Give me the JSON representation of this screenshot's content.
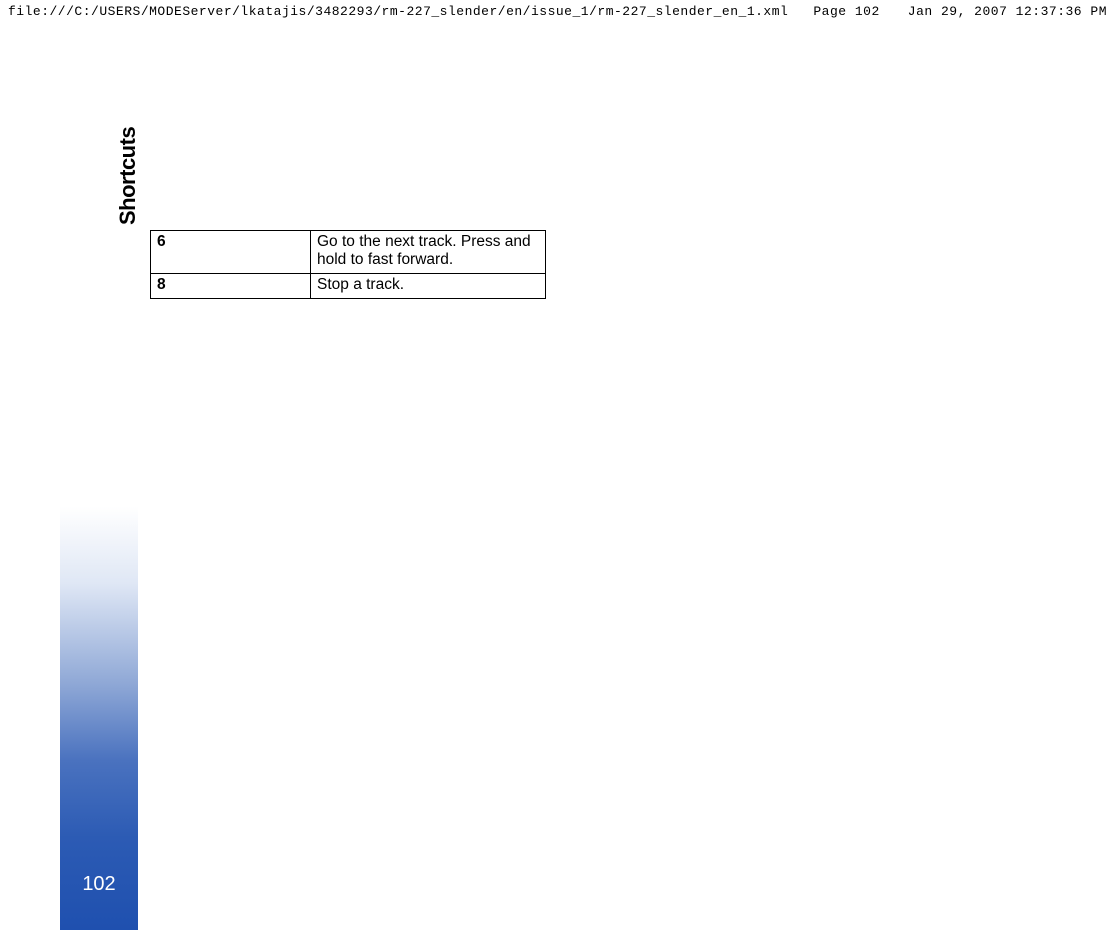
{
  "header": {
    "path": "file:///C:/USERS/MODEServer/lkatajis/3482293/rm-227_slender/en/issue_1/rm-227_slender_en_1.xml",
    "page_label": "Page 102",
    "timestamp": "Jan 29, 2007 12:37:36 PM"
  },
  "sidebar": {
    "label": "Shortcuts"
  },
  "page_number": "102",
  "table": {
    "rows": [
      {
        "key": "6",
        "desc": "Go to the next track. Press and hold to fast forward."
      },
      {
        "key": "8",
        "desc": "Stop a track."
      }
    ]
  }
}
